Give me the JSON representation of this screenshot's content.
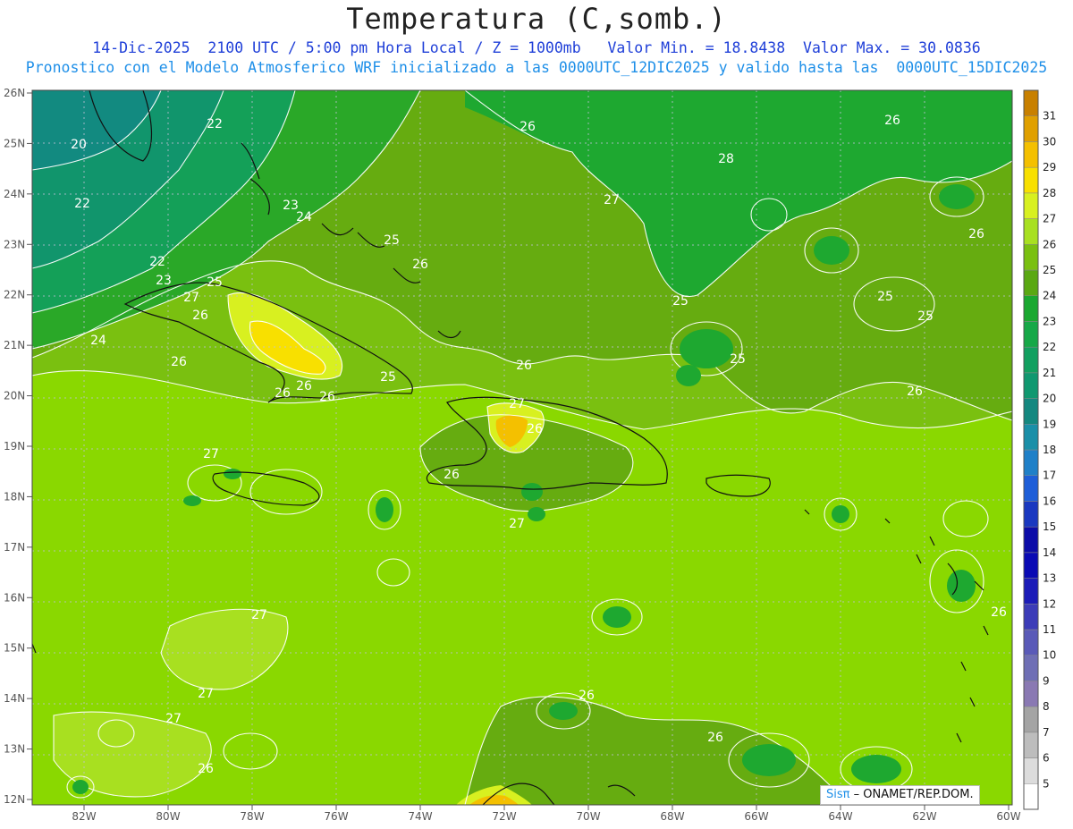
{
  "title": "Temperatura (C,somb.)",
  "subtitle_line1": "14-Dic-2025  2100 UTC / 5:00 pm Hora Local / Z = 1000mb   Valor Min. = 18.8438  Valor Max. = 30.0836",
  "subtitle_line2": "Pronostico con el Modelo Atmosferico WRF inicializado a las 0000UTC_12DIC2025 y valido hasta las  0000UTC_15DIC2025",
  "credit": {
    "brand": "Sisπ",
    "text": " – ONAMET/REP.DOM."
  },
  "lat_labels": [
    "26N",
    "25N",
    "24N",
    "23N",
    "22N",
    "21N",
    "20N",
    "19N",
    "18N",
    "17N",
    "16N",
    "15N",
    "14N",
    "13N",
    "12N"
  ],
  "lon_labels": [
    "82W",
    "80W",
    "78W",
    "76W",
    "74W",
    "72W",
    "70W",
    "68W",
    "66W",
    "64W",
    "62W",
    "60W"
  ],
  "colorbar": {
    "levels": [
      "5",
      "6",
      "7",
      "8",
      "9",
      "10",
      "11",
      "12",
      "13",
      "14",
      "15",
      "16",
      "17",
      "18",
      "19",
      "20",
      "21",
      "22",
      "23",
      "24",
      "25",
      "26",
      "27",
      "28",
      "29",
      "30",
      "31"
    ],
    "colors": [
      "#ffffff",
      "#dcdcdc",
      "#bdbdbd",
      "#a4a4a4",
      "#8a79b3",
      "#6f6fb5",
      "#5a5ab8",
      "#3c3cb8",
      "#1c1cb8",
      "#0a0ab4",
      "#0c0ca8",
      "#1a38c0",
      "#1e5ed8",
      "#1f80c8",
      "#1a8fa8",
      "#148880",
      "#109870",
      "#12a060",
      "#16a848",
      "#1aa830",
      "#5aa812",
      "#7ac010",
      "#a8e020",
      "#d8f020",
      "#f8e000",
      "#f4c000",
      "#e0a000",
      "#c88000"
    ]
  },
  "contour_labels": [
    "20",
    "22",
    "22",
    "22",
    "23",
    "27",
    "25",
    "26",
    "24",
    "26",
    "23",
    "24",
    "25",
    "26",
    "26",
    "27",
    "28",
    "26",
    "26",
    "25",
    "25",
    "25",
    "25",
    "26",
    "26",
    "25",
    "26",
    "26",
    "26",
    "27",
    "26",
    "26",
    "27",
    "27",
    "27",
    "27",
    "27",
    "26",
    "26",
    "26",
    "26"
  ]
}
